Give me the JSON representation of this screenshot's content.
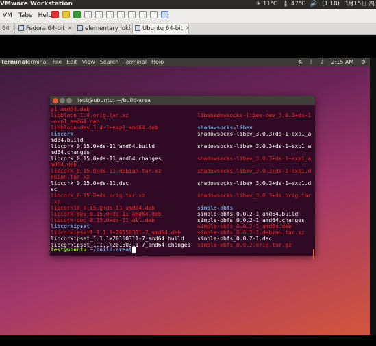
{
  "host": {
    "app_title": "VMware Workstation",
    "tray": [
      "☀ 11°C",
      "🌡 47°C",
      "🔊",
      "(1:18)",
      "3月15日 周"
    ]
  },
  "vmware": {
    "menu": [
      "VM",
      "Tabs",
      "Help"
    ],
    "tools": [
      {
        "name": "power-off-icon",
        "kind": "red"
      },
      {
        "name": "pause-icon",
        "kind": "yellow"
      },
      {
        "name": "play-icon",
        "kind": "green"
      },
      {
        "name": "restart-icon",
        "kind": "plain"
      },
      {
        "name": "snapshot-icon",
        "kind": "plain"
      },
      {
        "name": "revert-snapshot-icon",
        "kind": "plain"
      },
      {
        "name": "snapshot-manager-icon",
        "kind": "plain"
      },
      {
        "name": "sidebar-view-icon",
        "kind": "plain"
      },
      {
        "name": "console-view-icon",
        "kind": "plain"
      },
      {
        "name": "fullscreen-icon",
        "kind": "plain"
      },
      {
        "name": "unity-view-icon",
        "kind": "active"
      }
    ],
    "tabs": [
      {
        "label": "64",
        "close": "✕",
        "active": false
      },
      {
        "label": "Fedora 64-bit",
        "close": "✕",
        "active": false
      },
      {
        "label": "elementary loki",
        "close": "✕",
        "active": false
      },
      {
        "label": "Ubuntu 64-bit",
        "close": "✕",
        "active": true
      }
    ]
  },
  "guest": {
    "topbar": {
      "title": "Terminal",
      "menus": [
        "Terminal",
        "File",
        "Edit",
        "View",
        "Search",
        "Terminal",
        "Help"
      ],
      "time": "2:15 AM"
    }
  },
  "terminal": {
    "title": "test@ubuntu: ~/build-area",
    "prompt_user": "test@ubuntu",
    "prompt_path": ":~/build-area$",
    "left": [
      {
        "t": "p1_amd64.deb",
        "c": "red"
      },
      {
        "t": "libbloon_1.4.orig.tar.xz",
        "c": "red"
      },
      {
        "t": "~exp1_amd64.deb",
        "c": "red"
      },
      {
        "t": "libbloon-dev_1.4-1~exp1_amd64.deb",
        "c": "red"
      },
      {
        "t": "libcork",
        "c": "blue"
      },
      {
        "t": "md64.build",
        "c": "white"
      },
      {
        "t": "libcork_0.15.0+ds-11_amd64.build",
        "c": "white"
      },
      {
        "t": "md64.changes",
        "c": "white"
      },
      {
        "t": "libcork_0.15.0+ds-11_amd64.changes",
        "c": "white"
      },
      {
        "t": "md64.deb",
        "c": "red"
      },
      {
        "t": "libcork_0.15.0+ds-11.debian.tar.xz",
        "c": "red"
      },
      {
        "t": "ebian.tar.xz",
        "c": "red"
      },
      {
        "t": "libcork_0.15.0+ds-11.dsc",
        "c": "white"
      },
      {
        "t": "sc",
        "c": "white"
      },
      {
        "t": "libcork_0.15.0+ds.orig.tar.xz",
        "c": "red"
      },
      {
        "t": ".xz",
        "c": "red"
      },
      {
        "t": "libcork16_0.15.0+ds-11_amd64.deb",
        "c": "red"
      },
      {
        "t": "libcork-dev_0.15.0+ds-11_amd64.deb",
        "c": "red"
      },
      {
        "t": "libcork-doc_0.15.0+ds-11_all.deb",
        "c": "red"
      },
      {
        "t": "libcorkipset",
        "c": "blue"
      },
      {
        "t": "libcorkipset1_1.1.1+20150311-7_amd64.deb",
        "c": "red"
      },
      {
        "t": "libcorkipset_1.1.1+20150311-7_amd64.build",
        "c": "white"
      },
      {
        "t": "libcorkipset_1.1.1+20150311-7_amd64.changes",
        "c": "white"
      }
    ],
    "right": [
      {
        "t": "libshadowsocks-libev-dev_3.0.3+ds-1",
        "c": "red",
        "row": 1
      },
      {
        "t": "shadowsocks-libev",
        "c": "blue",
        "row": 3
      },
      {
        "t": "shadowsocks-libev_3.0.3+ds-1~exp1_a",
        "c": "white",
        "row": 4
      },
      {
        "t": "shadowsocks-libev_3.0.3+ds-1~exp1_a",
        "c": "white",
        "row": 6
      },
      {
        "t": "shadowsocks-libev_3.0.3+ds-1~exp1_a",
        "c": "red",
        "row": 8
      },
      {
        "t": "shadowsocks-libev_3.0.3+ds-1~exp1.d",
        "c": "red",
        "row": 10
      },
      {
        "t": "shadowsocks-libev_3.0.3+ds-1~exp1.d",
        "c": "white",
        "row": 12
      },
      {
        "t": "shadowsocks-libev_3.0.3+ds.orig.tar",
        "c": "red",
        "row": 14
      },
      {
        "t": "simple-obfs",
        "c": "blue",
        "row": 16
      },
      {
        "t": "simple-obfs_0.0.2-1_amd64.build",
        "c": "white",
        "row": 17
      },
      {
        "t": "simple-obfs_0.0.2-1_amd64.changes",
        "c": "white",
        "row": 18
      },
      {
        "t": "simple-obfs_0.0.2-1_amd64.deb",
        "c": "red",
        "row": 19
      },
      {
        "t": "simple-obfs_0.0.2-1.debian.tar.xz",
        "c": "red",
        "row": 20
      },
      {
        "t": "simple-obfs_0.0.2-1.dsc",
        "c": "white",
        "row": 21
      },
      {
        "t": "simple-obfs_0.0.2.orig.tar.gz",
        "c": "red",
        "row": 22
      }
    ]
  }
}
